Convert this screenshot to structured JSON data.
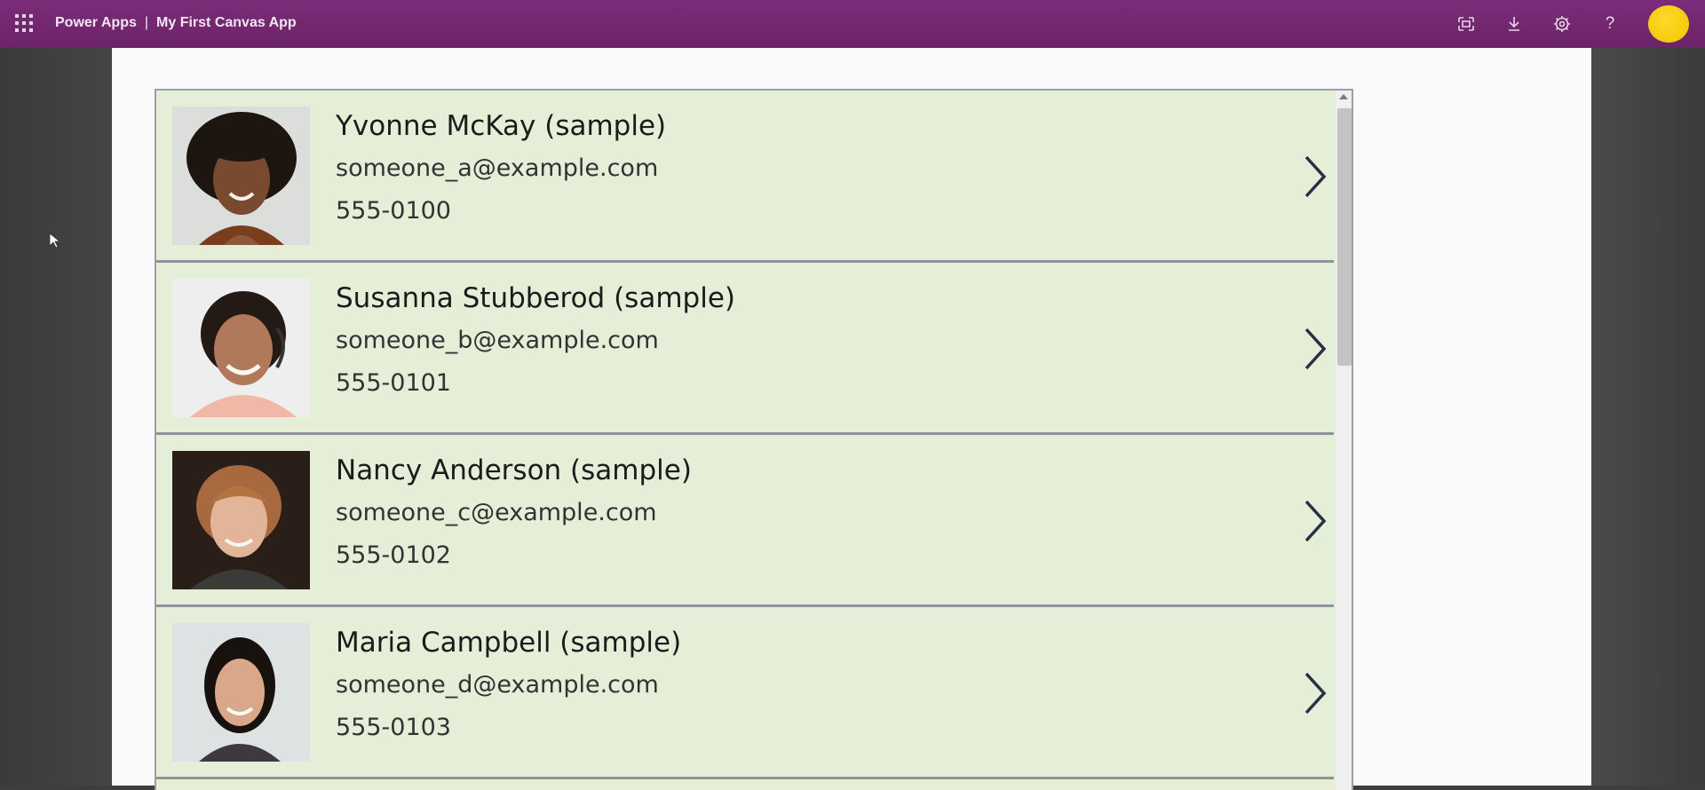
{
  "header": {
    "app_name": "Power Apps",
    "separator": "|",
    "app_title": "My First Canvas App",
    "icons": [
      "waffle-icon",
      "fit-screen-icon",
      "download-icon",
      "settings-icon",
      "help-icon",
      "user-avatar"
    ],
    "help_glyph": "?"
  },
  "gallery": {
    "items": [
      {
        "name": "Yvonne McKay (sample)",
        "email": "someone_a@example.com",
        "phone": "555-0100"
      },
      {
        "name": "Susanna Stubberod (sample)",
        "email": "someone_b@example.com",
        "phone": "555-0101"
      },
      {
        "name": "Nancy Anderson (sample)",
        "email": "someone_c@example.com",
        "phone": "555-0102"
      },
      {
        "name": "Maria Campbell (sample)",
        "email": "someone_d@example.com",
        "phone": "555-0103"
      }
    ]
  },
  "colors": {
    "topbar": "#742774",
    "row_background": "#e5efd8",
    "avatar": "#ffd92a"
  }
}
